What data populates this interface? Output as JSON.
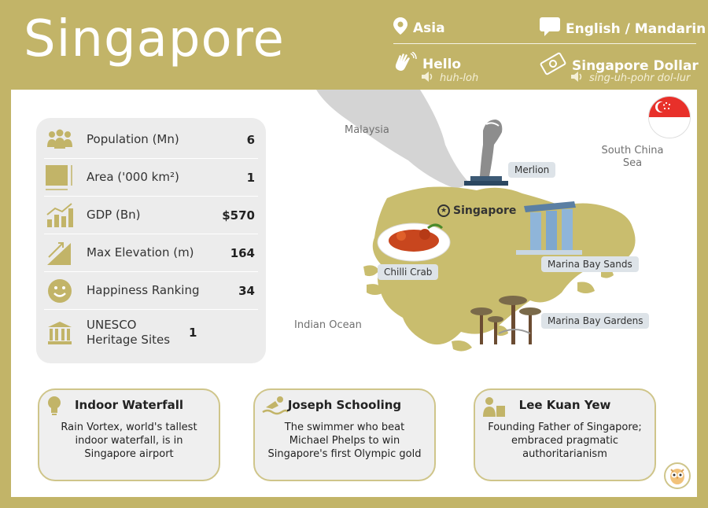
{
  "header": {
    "title": "Singapore",
    "continent": "Asia",
    "languages": "English / Mandarin",
    "greeting": "Hello",
    "greeting_pronunciation": "huh-loh",
    "currency": "Singapore Dollar",
    "currency_pronunciation": "sing-uh-pohr dol-lur"
  },
  "stats": [
    {
      "icon": "population-icon",
      "label": "Population (Mn)",
      "value": "6"
    },
    {
      "icon": "area-icon",
      "label": "Area ('000 km²)",
      "value": "1"
    },
    {
      "icon": "gdp-chart-icon",
      "label": "GDP (Bn)",
      "value": "$570"
    },
    {
      "icon": "elevation-icon",
      "label": "Max Elevation (m)",
      "value": "164"
    },
    {
      "icon": "smiley-icon",
      "label": "Happiness Ranking",
      "value": "34"
    },
    {
      "icon": "museum-icon",
      "label": "UNESCO Heritage Sites",
      "value": "1"
    }
  ],
  "map": {
    "neighbor": "Malaysia",
    "sea_east": "South China Sea",
    "sea_south": "Indian Ocean",
    "capital": "Singapore",
    "landmarks": {
      "merlion": "Merlion",
      "marina_bay_sands": "Marina Bay Sands",
      "chilli_crab": "Chilli Crab",
      "marina_bay_gardens": "Marina Bay Gardens"
    }
  },
  "facts": [
    {
      "title": "Indoor Waterfall",
      "text": "Rain Vortex, world's tallest indoor waterfall, is in Singapore airport"
    },
    {
      "title": "Joseph Schooling",
      "text": "The swimmer who beat Michael Phelps to win Singapore's first Olympic gold"
    },
    {
      "title": "Lee Kuan Yew",
      "text": "Founding Father of Singapore; embraced pragmatic authoritarianism"
    }
  ],
  "colors": {
    "brand_olive": "#c2b468",
    "land": "#c9bd6e",
    "neighbor_land": "#d4d4d4",
    "flag_red": "#e8302a"
  }
}
